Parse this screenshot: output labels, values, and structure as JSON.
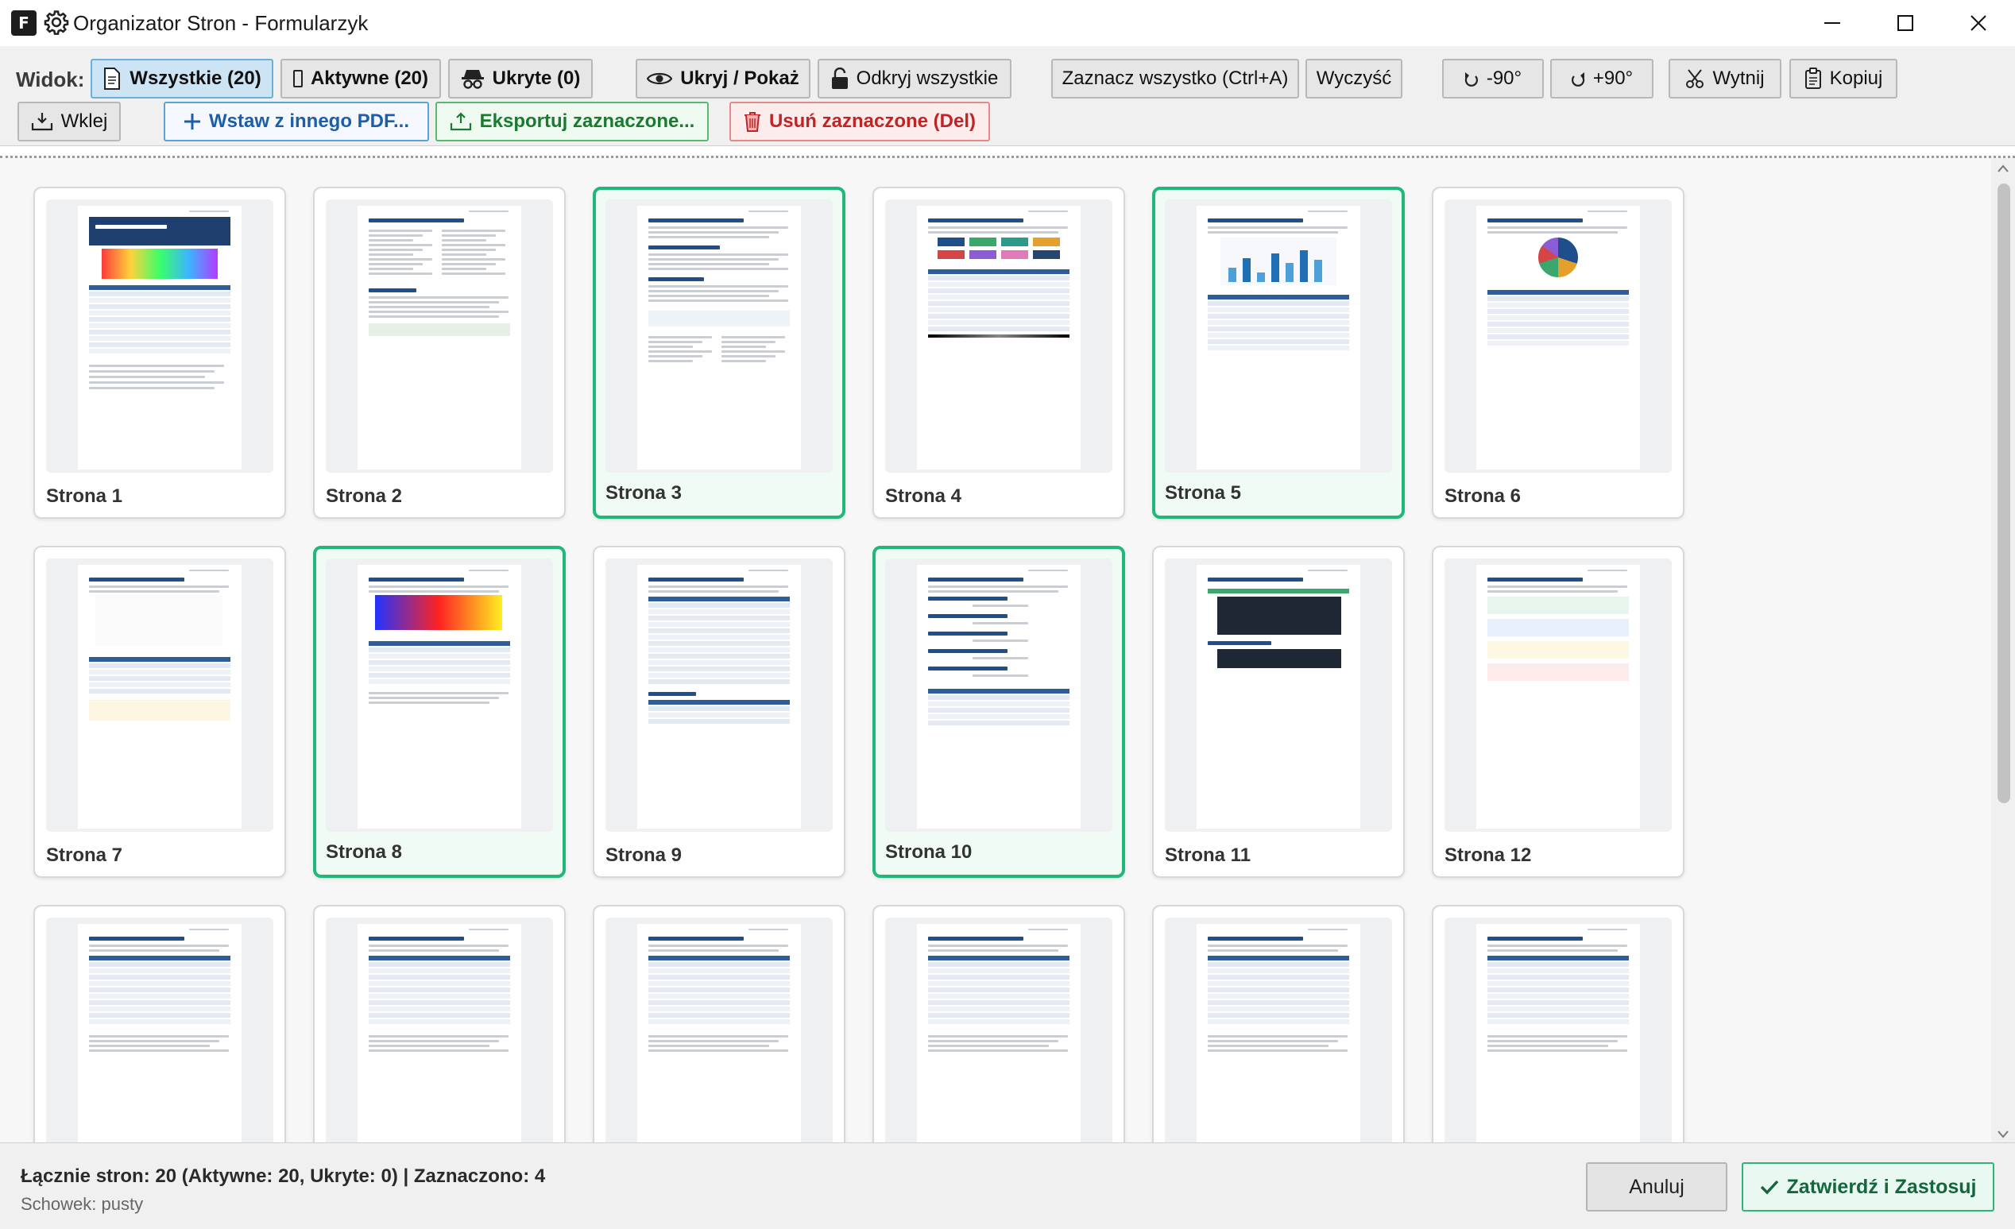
{
  "window": {
    "app_icon_letter": "F",
    "title": "Organizator Stron - Formularzyk"
  },
  "toolbar": {
    "view_label": "Widok:",
    "all_label": "Wszystkie (20)",
    "active_label": "Aktywne (20)",
    "hidden_label": "Ukryte (0)",
    "toggle_hide_label": "Ukryj / Pokaż",
    "reveal_all_label": "Odkryj wszystkie",
    "select_all_label": "Zaznacz wszystko (Ctrl+A)",
    "clear_label": "Wyczyść",
    "rotate_left_label": "-90°",
    "rotate_right_label": "+90°",
    "cut_label": "Wytnij",
    "copy_label": "Kopiuj",
    "paste_label": "Wklej",
    "insert_label": "Wstaw z innego PDF...",
    "export_label": "Eksportuj zaznaczone...",
    "delete_label": "Usuń zaznaczone (Del)"
  },
  "pages": [
    {
      "label": "Strona 1",
      "selected": false
    },
    {
      "label": "Strona 2",
      "selected": false
    },
    {
      "label": "Strona 3",
      "selected": true
    },
    {
      "label": "Strona 4",
      "selected": false
    },
    {
      "label": "Strona 5",
      "selected": true
    },
    {
      "label": "Strona 6",
      "selected": false
    },
    {
      "label": "Strona 7",
      "selected": false
    },
    {
      "label": "Strona 8",
      "selected": true
    },
    {
      "label": "Strona 9",
      "selected": false
    },
    {
      "label": "Strona 10",
      "selected": true
    },
    {
      "label": "Strona 11",
      "selected": false
    },
    {
      "label": "Strona 12",
      "selected": false
    },
    {
      "label": "",
      "selected": false
    },
    {
      "label": "",
      "selected": false
    },
    {
      "label": "",
      "selected": false
    },
    {
      "label": "",
      "selected": false
    },
    {
      "label": "",
      "selected": false
    },
    {
      "label": "",
      "selected": false
    }
  ],
  "status": {
    "summary": "Łącznie stron: 20 (Aktywne: 20, Ukryte: 0) | Zaznaczono: 4",
    "clipboard": "Schowek: pusty"
  },
  "footer": {
    "cancel_label": "Anuluj",
    "apply_label": "Zatwierdź i Zastosuj"
  },
  "colors": {
    "accent_selected": "#1fb87a",
    "active_view": "#cde4f5",
    "danger": "#c02424"
  }
}
